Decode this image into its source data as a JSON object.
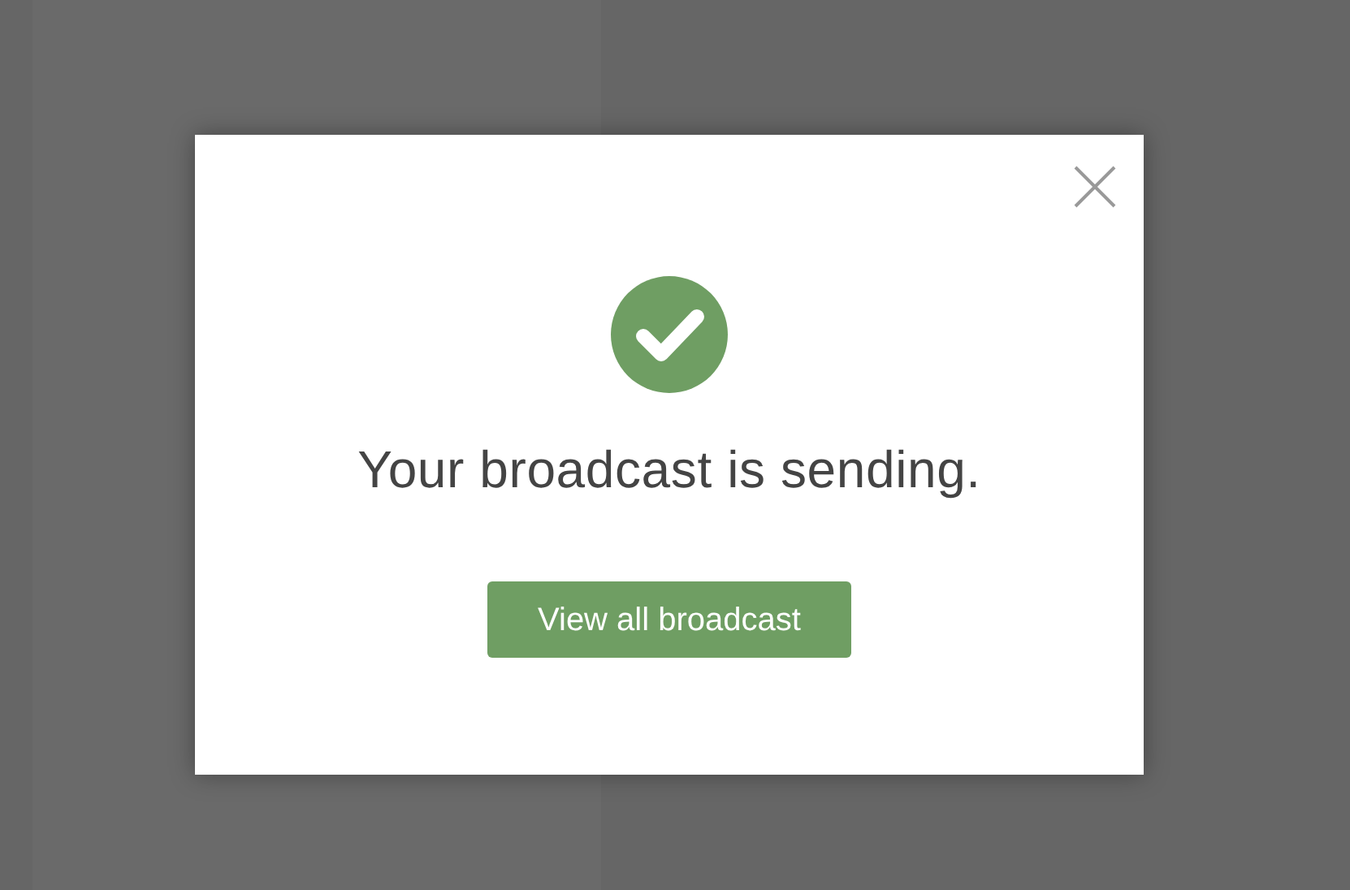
{
  "dialog": {
    "message": "Your broadcast is sending.",
    "button": "View all broadcast"
  }
}
